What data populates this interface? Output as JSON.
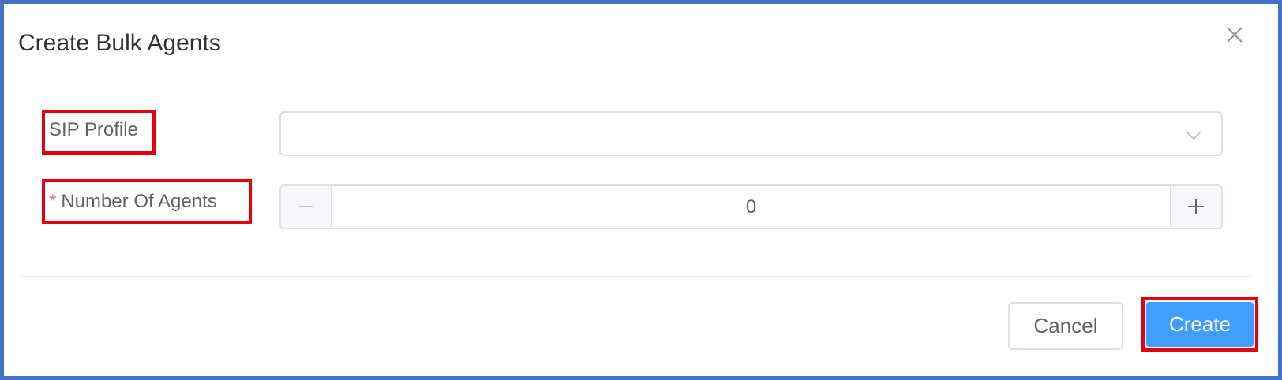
{
  "dialog": {
    "title": "Create Bulk Agents",
    "close_icon": "close-icon"
  },
  "form": {
    "sip_profile": {
      "label": "SIP Profile",
      "value": "",
      "icon": "chevron-down-icon"
    },
    "number_of_agents": {
      "required_mark": "*",
      "label": "Number Of Agents",
      "value": "0",
      "minus_icon": "minus-icon",
      "plus_icon": "plus-icon"
    }
  },
  "footer": {
    "cancel_label": "Cancel",
    "create_label": "Create"
  },
  "colors": {
    "frame": "#4472c4",
    "highlight": "#e3000f",
    "primary": "#409eff",
    "required": "#f56c6c"
  }
}
